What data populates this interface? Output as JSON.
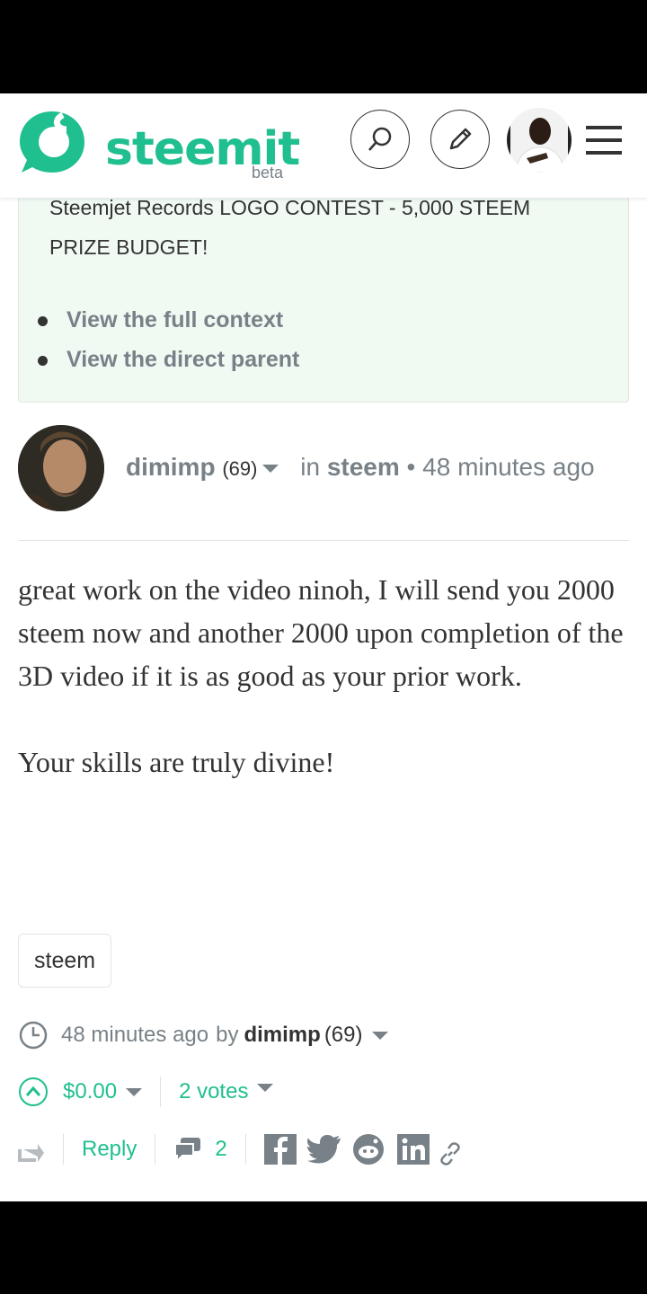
{
  "app": {
    "logo_text": "steemit",
    "logo_badge": "beta",
    "brand_color": "#1fbf8f"
  },
  "nav": {
    "search_icon": "search-icon",
    "edit_icon": "pencil-icon",
    "menu_icon": "hamburger-menu-icon"
  },
  "context": {
    "title": "Steemjet Records LOGO CONTEST - 5,000 STEEM PRIZE BUDGET!",
    "links": [
      "View the full context",
      "View the direct parent"
    ]
  },
  "comment": {
    "author": "dimimp",
    "reputation": "(69)",
    "in_label": "in",
    "category": "steem",
    "bullet": "•",
    "time": "48 minutes ago",
    "paragraphs": [
      "great work on the video ninoh, I will send you 2000 steem now and another 2000 upon completion of the 3D video if it is as good as your prior work.",
      "Your skills are truly divine!"
    ],
    "tag": "steem"
  },
  "footer": {
    "time": "48 minutes ago",
    "by_label": "by",
    "author": "dimimp",
    "reputation": "(69)",
    "payout": "$0.00",
    "votes": "2 votes",
    "reply_label": "Reply",
    "comment_count": "2"
  }
}
